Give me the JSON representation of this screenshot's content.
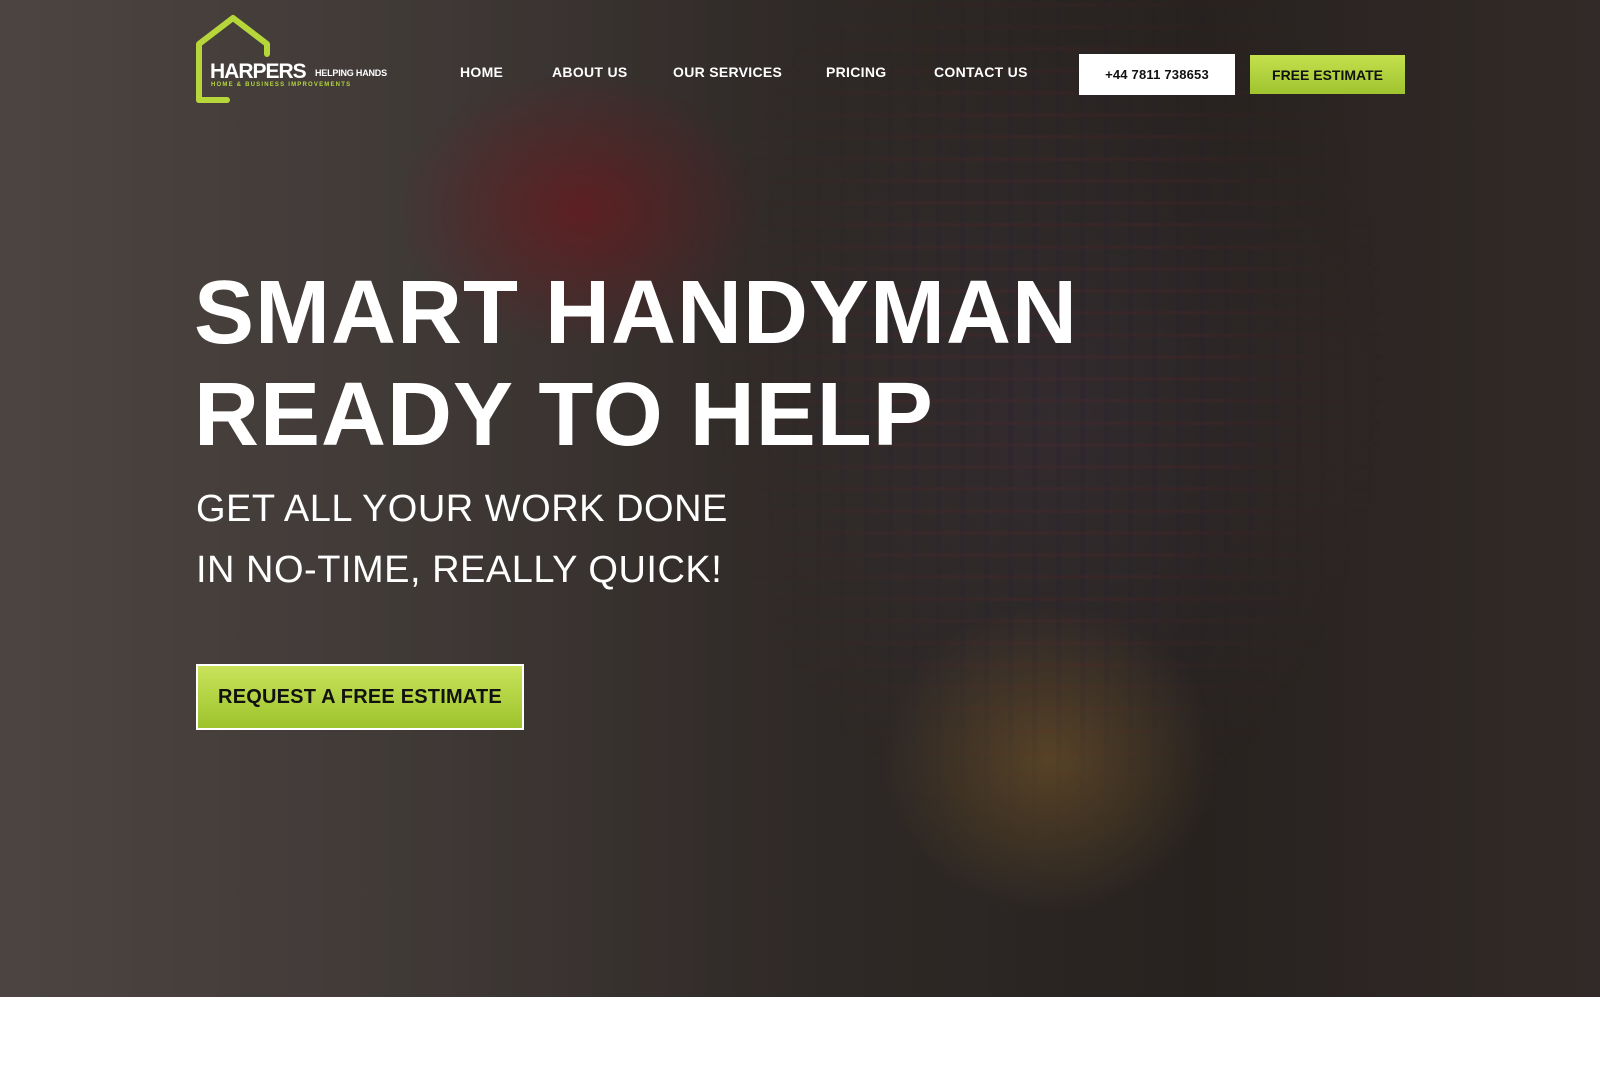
{
  "brand": {
    "name": "HARPERS",
    "tagline": "HELPING HANDS",
    "subtitle": "HOME & BUSINESS IMPROVEMENTS",
    "accent_color": "#b6d63a",
    "icon": "house-outline-icon"
  },
  "nav": {
    "items": [
      {
        "label": "HOME"
      },
      {
        "label": "ABOUT US"
      },
      {
        "label": "OUR SERVICES"
      },
      {
        "label": "PRICING"
      },
      {
        "label": "CONTACT US"
      }
    ],
    "phone": "+44 7811 738653",
    "estimate_label": "FREE ESTIMATE"
  },
  "hero": {
    "headline_line1": "SMART HANDYMAN",
    "headline_line2": "READY TO HELP",
    "sub_line1": "GET ALL YOUR WORK DONE",
    "sub_line2": "IN NO-TIME, REALLY QUICK!",
    "cta_label": "REQUEST A FREE ESTIMATE"
  }
}
